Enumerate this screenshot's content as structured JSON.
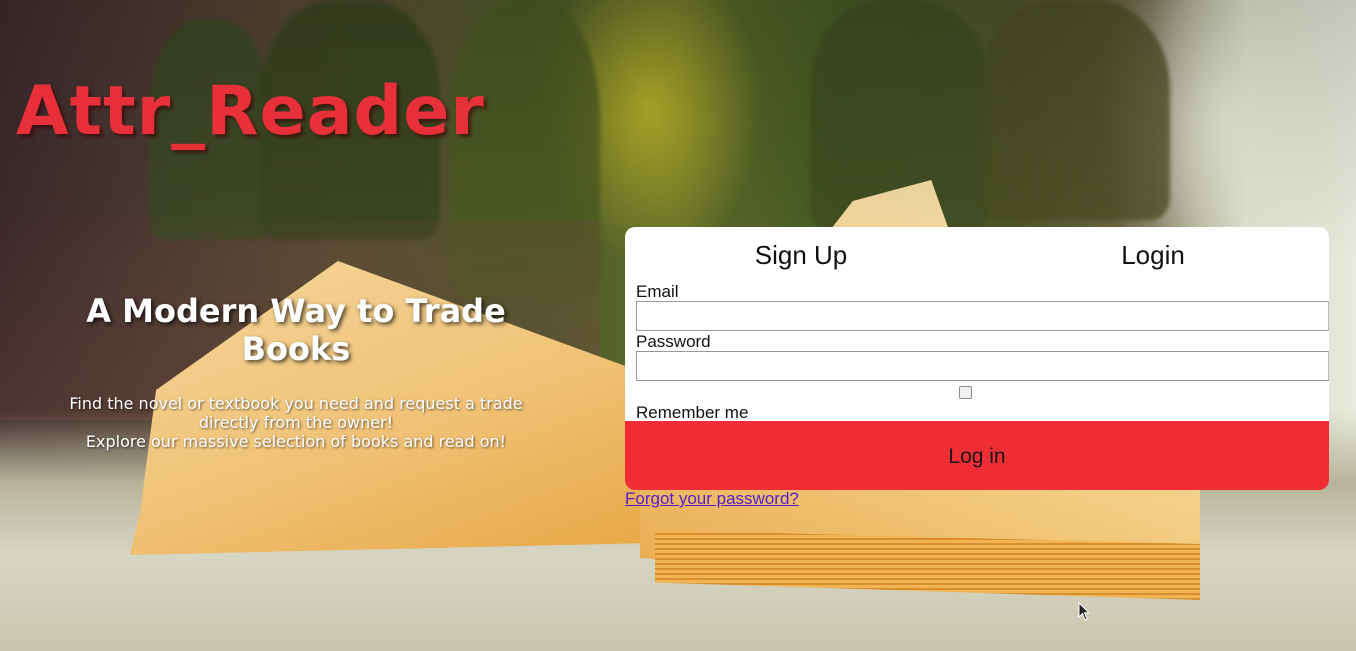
{
  "brand": {
    "name": "Attr_Reader",
    "color": "#e8303a"
  },
  "hero": {
    "title": "A Modern Way to Trade Books",
    "line1": "Find the novel or textbook you need and request a trade directly from the owner!",
    "line2": "Explore our massive selection of books and read on!"
  },
  "auth": {
    "tabs": [
      {
        "label": "Sign Up"
      },
      {
        "label": "Login"
      }
    ],
    "email_label": "Email",
    "email_value": "",
    "password_label": "Password",
    "password_value": "",
    "remember_label": "Remember me",
    "remember_checked": false,
    "submit_label": "Log in",
    "submit_color": "#ef2d35",
    "forgot_link": "Forgot your password?"
  }
}
